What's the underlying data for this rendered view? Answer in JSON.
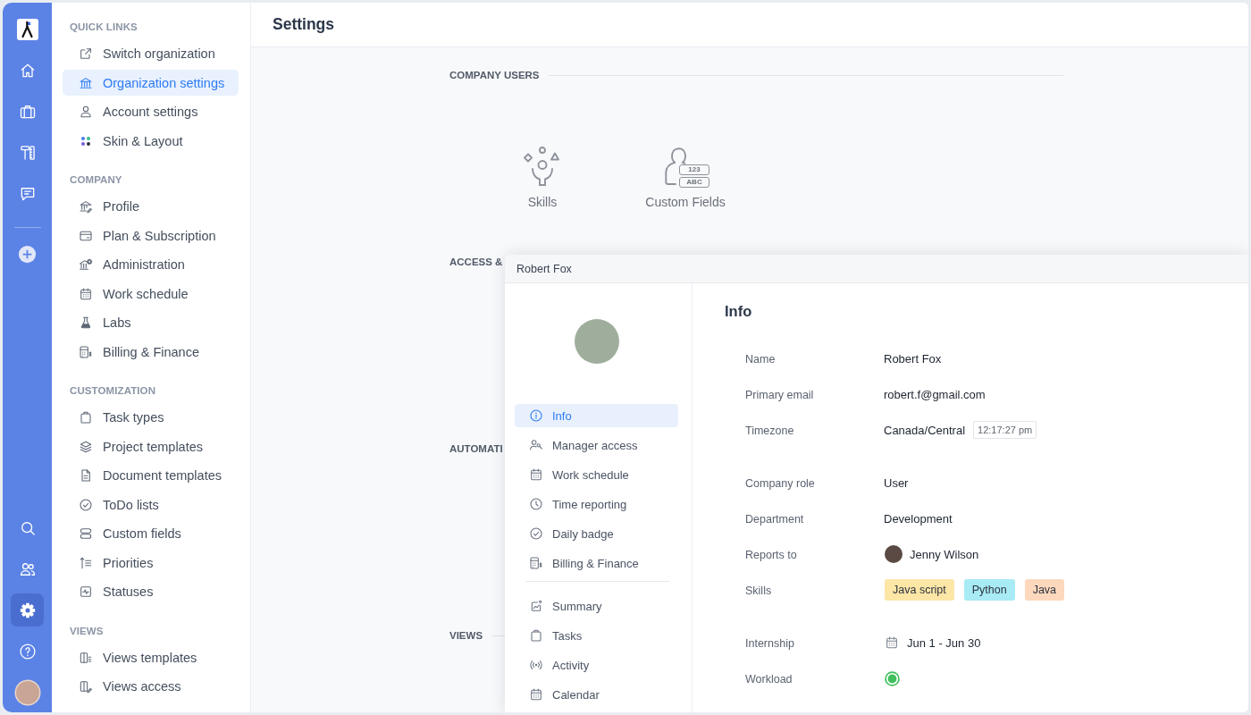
{
  "rail": {
    "top": [
      {
        "selected": false
      },
      {
        "selected": false
      },
      {
        "selected": false
      },
      {
        "selected": false
      }
    ],
    "bottom": [
      {
        "selected": false
      },
      {
        "selected": false
      },
      {
        "selected": true
      },
      {
        "selected": false
      }
    ]
  },
  "sidebar": {
    "sections": [
      {
        "title": "QUICK LINKS",
        "items": [
          {
            "label": "Switch organization",
            "selected": false
          },
          {
            "label": "Organization settings",
            "selected": true
          },
          {
            "label": "Account settings",
            "selected": false
          },
          {
            "label": "Skin & Layout",
            "selected": false
          }
        ]
      },
      {
        "title": "COMPANY",
        "items": [
          {
            "label": "Profile",
            "selected": false
          },
          {
            "label": "Plan & Subscription",
            "selected": false
          },
          {
            "label": "Administration",
            "selected": false
          },
          {
            "label": "Work schedule",
            "selected": false
          },
          {
            "label": "Labs",
            "selected": false
          },
          {
            "label": "Billing & Finance",
            "selected": false
          }
        ]
      },
      {
        "title": "CUSTOMIZATION",
        "items": [
          {
            "label": "Task types",
            "selected": false
          },
          {
            "label": "Project templates",
            "selected": false
          },
          {
            "label": "Document templates",
            "selected": false
          },
          {
            "label": "ToDo lists",
            "selected": false
          },
          {
            "label": "Custom fields",
            "selected": false
          },
          {
            "label": "Priorities",
            "selected": false
          },
          {
            "label": "Statuses",
            "selected": false
          }
        ]
      },
      {
        "title": "VIEWS",
        "items": [
          {
            "label": "Views templates",
            "selected": false
          },
          {
            "label": "Views access",
            "selected": false
          }
        ]
      }
    ]
  },
  "header": {
    "title": "Settings"
  },
  "sections": [
    {
      "title": "COMPANY USERS",
      "tiles": [
        {
          "label": "Skills"
        },
        {
          "label": "Custom Fields",
          "icon_chips": [
            "123",
            "ABC"
          ]
        }
      ]
    },
    {
      "title": "ACCESS &"
    },
    {
      "title": "AUTOMATI"
    },
    {
      "title": "VIEWS"
    }
  ],
  "user_panel": {
    "title": "Robert Fox",
    "nav": [
      {
        "items": [
          {
            "label": "Info",
            "selected": true
          },
          {
            "label": "Manager access",
            "selected": false
          },
          {
            "label": "Work schedule",
            "selected": false
          },
          {
            "label": "Time reporting",
            "selected": false
          },
          {
            "label": "Daily badge",
            "selected": false
          },
          {
            "label": "Billing & Finance",
            "selected": false
          }
        ]
      },
      {
        "items": [
          {
            "label": "Summary",
            "selected": false
          },
          {
            "label": "Tasks",
            "selected": false
          },
          {
            "label": "Activity",
            "selected": false
          },
          {
            "label": "Calendar",
            "selected": false
          }
        ]
      }
    ],
    "info": {
      "title": "Info",
      "groups": [
        {
          "rows": [
            {
              "kind": "text",
              "label": "Name",
              "value": "Robert Fox"
            },
            {
              "kind": "text",
              "label": "Primary email",
              "value": "robert.f@gmail.com"
            },
            {
              "kind": "timezone",
              "label": "Timezone",
              "value": "Canada/Central",
              "time": "12:17:27 pm"
            }
          ]
        },
        {
          "rows": [
            {
              "kind": "text",
              "label": "Company role",
              "value": "User"
            },
            {
              "kind": "text",
              "label": "Department",
              "value": "Development"
            },
            {
              "kind": "person",
              "label": "Reports to",
              "value": "Jenny Wilson"
            },
            {
              "kind": "tags",
              "label": "Skills",
              "tags": [
                {
                  "label": "Java script",
                  "color": "#fde6a6"
                },
                {
                  "label": "Python",
                  "color": "#a8ebf5"
                },
                {
                  "label": "Java",
                  "color": "#fdd8bd"
                }
              ]
            }
          ]
        },
        {
          "rows": [
            {
              "kind": "date",
              "label": "Internship",
              "value": "Jun 1 - Jun 30"
            },
            {
              "kind": "status",
              "label": "Workload",
              "color": "#3fc05c"
            }
          ]
        }
      ]
    }
  }
}
